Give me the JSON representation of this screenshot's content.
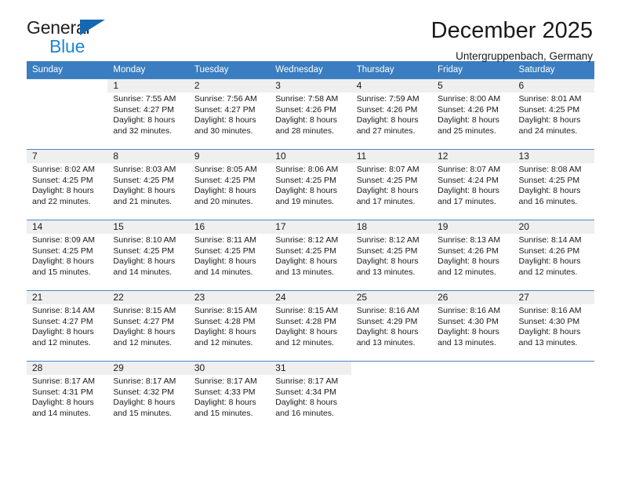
{
  "brand": {
    "name_part1": "General",
    "name_part2": "Blue",
    "triangle_icon": "triangle-icon",
    "color_dark": "#231f20",
    "color_blue": "#1f86d4"
  },
  "header": {
    "month_title": "December 2025",
    "location": "Untergruppenbach, Germany"
  },
  "colors": {
    "header_row_bg": "#3a7dc0",
    "day_strip_bg": "#efefef",
    "cell_border": "#4a86c5",
    "text": "#1a1a1a"
  },
  "weekdays": [
    "Sunday",
    "Monday",
    "Tuesday",
    "Wednesday",
    "Thursday",
    "Friday",
    "Saturday"
  ],
  "labels": {
    "sunrise_prefix": "Sunrise:",
    "sunset_prefix": "Sunset:",
    "daylight_prefix": "Daylight:"
  },
  "weeks": [
    [
      {
        "day": "",
        "l1": "",
        "l2": "",
        "l3": "",
        "l4": ""
      },
      {
        "day": "1",
        "l1": "Sunrise: 7:55 AM",
        "l2": "Sunset: 4:27 PM",
        "l3": "Daylight: 8 hours",
        "l4": "and 32 minutes."
      },
      {
        "day": "2",
        "l1": "Sunrise: 7:56 AM",
        "l2": "Sunset: 4:27 PM",
        "l3": "Daylight: 8 hours",
        "l4": "and 30 minutes."
      },
      {
        "day": "3",
        "l1": "Sunrise: 7:58 AM",
        "l2": "Sunset: 4:26 PM",
        "l3": "Daylight: 8 hours",
        "l4": "and 28 minutes."
      },
      {
        "day": "4",
        "l1": "Sunrise: 7:59 AM",
        "l2": "Sunset: 4:26 PM",
        "l3": "Daylight: 8 hours",
        "l4": "and 27 minutes."
      },
      {
        "day": "5",
        "l1": "Sunrise: 8:00 AM",
        "l2": "Sunset: 4:26 PM",
        "l3": "Daylight: 8 hours",
        "l4": "and 25 minutes."
      },
      {
        "day": "6",
        "l1": "Sunrise: 8:01 AM",
        "l2": "Sunset: 4:25 PM",
        "l3": "Daylight: 8 hours",
        "l4": "and 24 minutes."
      }
    ],
    [
      {
        "day": "7",
        "l1": "Sunrise: 8:02 AM",
        "l2": "Sunset: 4:25 PM",
        "l3": "Daylight: 8 hours",
        "l4": "and 22 minutes."
      },
      {
        "day": "8",
        "l1": "Sunrise: 8:03 AM",
        "l2": "Sunset: 4:25 PM",
        "l3": "Daylight: 8 hours",
        "l4": "and 21 minutes."
      },
      {
        "day": "9",
        "l1": "Sunrise: 8:05 AM",
        "l2": "Sunset: 4:25 PM",
        "l3": "Daylight: 8 hours",
        "l4": "and 20 minutes."
      },
      {
        "day": "10",
        "l1": "Sunrise: 8:06 AM",
        "l2": "Sunset: 4:25 PM",
        "l3": "Daylight: 8 hours",
        "l4": "and 19 minutes."
      },
      {
        "day": "11",
        "l1": "Sunrise: 8:07 AM",
        "l2": "Sunset: 4:25 PM",
        "l3": "Daylight: 8 hours",
        "l4": "and 17 minutes."
      },
      {
        "day": "12",
        "l1": "Sunrise: 8:07 AM",
        "l2": "Sunset: 4:24 PM",
        "l3": "Daylight: 8 hours",
        "l4": "and 17 minutes."
      },
      {
        "day": "13",
        "l1": "Sunrise: 8:08 AM",
        "l2": "Sunset: 4:25 PM",
        "l3": "Daylight: 8 hours",
        "l4": "and 16 minutes."
      }
    ],
    [
      {
        "day": "14",
        "l1": "Sunrise: 8:09 AM",
        "l2": "Sunset: 4:25 PM",
        "l3": "Daylight: 8 hours",
        "l4": "and 15 minutes."
      },
      {
        "day": "15",
        "l1": "Sunrise: 8:10 AM",
        "l2": "Sunset: 4:25 PM",
        "l3": "Daylight: 8 hours",
        "l4": "and 14 minutes."
      },
      {
        "day": "16",
        "l1": "Sunrise: 8:11 AM",
        "l2": "Sunset: 4:25 PM",
        "l3": "Daylight: 8 hours",
        "l4": "and 14 minutes."
      },
      {
        "day": "17",
        "l1": "Sunrise: 8:12 AM",
        "l2": "Sunset: 4:25 PM",
        "l3": "Daylight: 8 hours",
        "l4": "and 13 minutes."
      },
      {
        "day": "18",
        "l1": "Sunrise: 8:12 AM",
        "l2": "Sunset: 4:25 PM",
        "l3": "Daylight: 8 hours",
        "l4": "and 13 minutes."
      },
      {
        "day": "19",
        "l1": "Sunrise: 8:13 AM",
        "l2": "Sunset: 4:26 PM",
        "l3": "Daylight: 8 hours",
        "l4": "and 12 minutes."
      },
      {
        "day": "20",
        "l1": "Sunrise: 8:14 AM",
        "l2": "Sunset: 4:26 PM",
        "l3": "Daylight: 8 hours",
        "l4": "and 12 minutes."
      }
    ],
    [
      {
        "day": "21",
        "l1": "Sunrise: 8:14 AM",
        "l2": "Sunset: 4:27 PM",
        "l3": "Daylight: 8 hours",
        "l4": "and 12 minutes."
      },
      {
        "day": "22",
        "l1": "Sunrise: 8:15 AM",
        "l2": "Sunset: 4:27 PM",
        "l3": "Daylight: 8 hours",
        "l4": "and 12 minutes."
      },
      {
        "day": "23",
        "l1": "Sunrise: 8:15 AM",
        "l2": "Sunset: 4:28 PM",
        "l3": "Daylight: 8 hours",
        "l4": "and 12 minutes."
      },
      {
        "day": "24",
        "l1": "Sunrise: 8:15 AM",
        "l2": "Sunset: 4:28 PM",
        "l3": "Daylight: 8 hours",
        "l4": "and 12 minutes."
      },
      {
        "day": "25",
        "l1": "Sunrise: 8:16 AM",
        "l2": "Sunset: 4:29 PM",
        "l3": "Daylight: 8 hours",
        "l4": "and 13 minutes."
      },
      {
        "day": "26",
        "l1": "Sunrise: 8:16 AM",
        "l2": "Sunset: 4:30 PM",
        "l3": "Daylight: 8 hours",
        "l4": "and 13 minutes."
      },
      {
        "day": "27",
        "l1": "Sunrise: 8:16 AM",
        "l2": "Sunset: 4:30 PM",
        "l3": "Daylight: 8 hours",
        "l4": "and 13 minutes."
      }
    ],
    [
      {
        "day": "28",
        "l1": "Sunrise: 8:17 AM",
        "l2": "Sunset: 4:31 PM",
        "l3": "Daylight: 8 hours",
        "l4": "and 14 minutes."
      },
      {
        "day": "29",
        "l1": "Sunrise: 8:17 AM",
        "l2": "Sunset: 4:32 PM",
        "l3": "Daylight: 8 hours",
        "l4": "and 15 minutes."
      },
      {
        "day": "30",
        "l1": "Sunrise: 8:17 AM",
        "l2": "Sunset: 4:33 PM",
        "l3": "Daylight: 8 hours",
        "l4": "and 15 minutes."
      },
      {
        "day": "31",
        "l1": "Sunrise: 8:17 AM",
        "l2": "Sunset: 4:34 PM",
        "l3": "Daylight: 8 hours",
        "l4": "and 16 minutes."
      },
      {
        "day": "",
        "l1": "",
        "l2": "",
        "l3": "",
        "l4": ""
      },
      {
        "day": "",
        "l1": "",
        "l2": "",
        "l3": "",
        "l4": ""
      },
      {
        "day": "",
        "l1": "",
        "l2": "",
        "l3": "",
        "l4": ""
      }
    ]
  ]
}
